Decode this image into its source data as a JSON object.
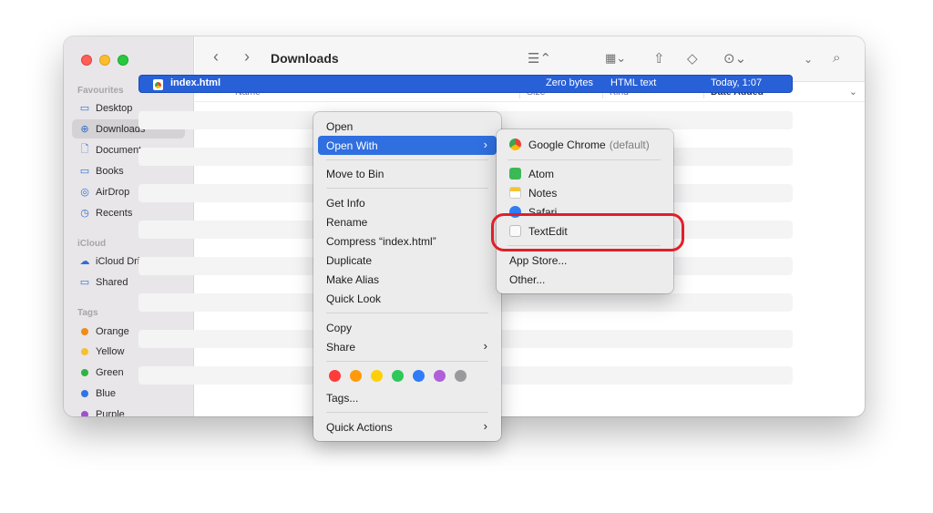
{
  "window": {
    "title": "Downloads"
  },
  "sidebar": {
    "favourites_header": "Favourites",
    "favourites": [
      {
        "label": "Desktop",
        "icon": "desktop-icon",
        "glyph": "▭"
      },
      {
        "label": "Downloads",
        "icon": "downloads-icon",
        "glyph": "⊕"
      },
      {
        "label": "Documents",
        "icon": "document-icon",
        "glyph": "🗋"
      },
      {
        "label": "Books",
        "icon": "folder-icon",
        "glyph": "▭"
      },
      {
        "label": "AirDrop",
        "icon": "airdrop-icon",
        "glyph": "◎"
      },
      {
        "label": "Recents",
        "icon": "clock-icon",
        "glyph": "◷"
      }
    ],
    "icloud_header": "iCloud",
    "icloud": [
      {
        "label": "iCloud Drive",
        "icon": "cloud-icon",
        "glyph": "☁"
      },
      {
        "label": "Shared",
        "icon": "shared-folder-icon",
        "glyph": "▭"
      }
    ],
    "tags_header": "Tags",
    "tags": [
      {
        "label": "Orange",
        "color": "#f08c1a"
      },
      {
        "label": "Yellow",
        "color": "#f5c22e"
      },
      {
        "label": "Green",
        "color": "#2fb344"
      },
      {
        "label": "Blue",
        "color": "#2f74e8"
      },
      {
        "label": "Purple",
        "color": "#a14fcf"
      }
    ]
  },
  "columns": {
    "name": "Name",
    "size": "Size",
    "kind": "Kind",
    "date": "Date Added"
  },
  "file": {
    "name": "index.html",
    "size": "Zero bytes",
    "kind": "HTML text",
    "date": "Today, 1:07"
  },
  "context_menu": {
    "open": "Open",
    "open_with": "Open With",
    "move_to_bin": "Move to Bin",
    "get_info": "Get Info",
    "rename": "Rename",
    "compress": "Compress “index.html”",
    "duplicate": "Duplicate",
    "make_alias": "Make Alias",
    "quick_look": "Quick Look",
    "copy": "Copy",
    "share": "Share",
    "tags": "Tags...",
    "quick_actions": "Quick Actions",
    "tag_colors": [
      "#fe3b3b",
      "#fe9a0a",
      "#fecf0a",
      "#2fc85a",
      "#2f7cf6",
      "#b05fd8",
      "#9a9a9d"
    ]
  },
  "open_with_menu": {
    "chrome": "Google Chrome",
    "chrome_default": "(default)",
    "atom": "Atom",
    "notes": "Notes",
    "safari": "Safari",
    "textedit": "TextEdit",
    "app_store": "App Store...",
    "other": "Other..."
  },
  "accent_color": "#2f6fe0",
  "annotation_color": "#e01f2a"
}
